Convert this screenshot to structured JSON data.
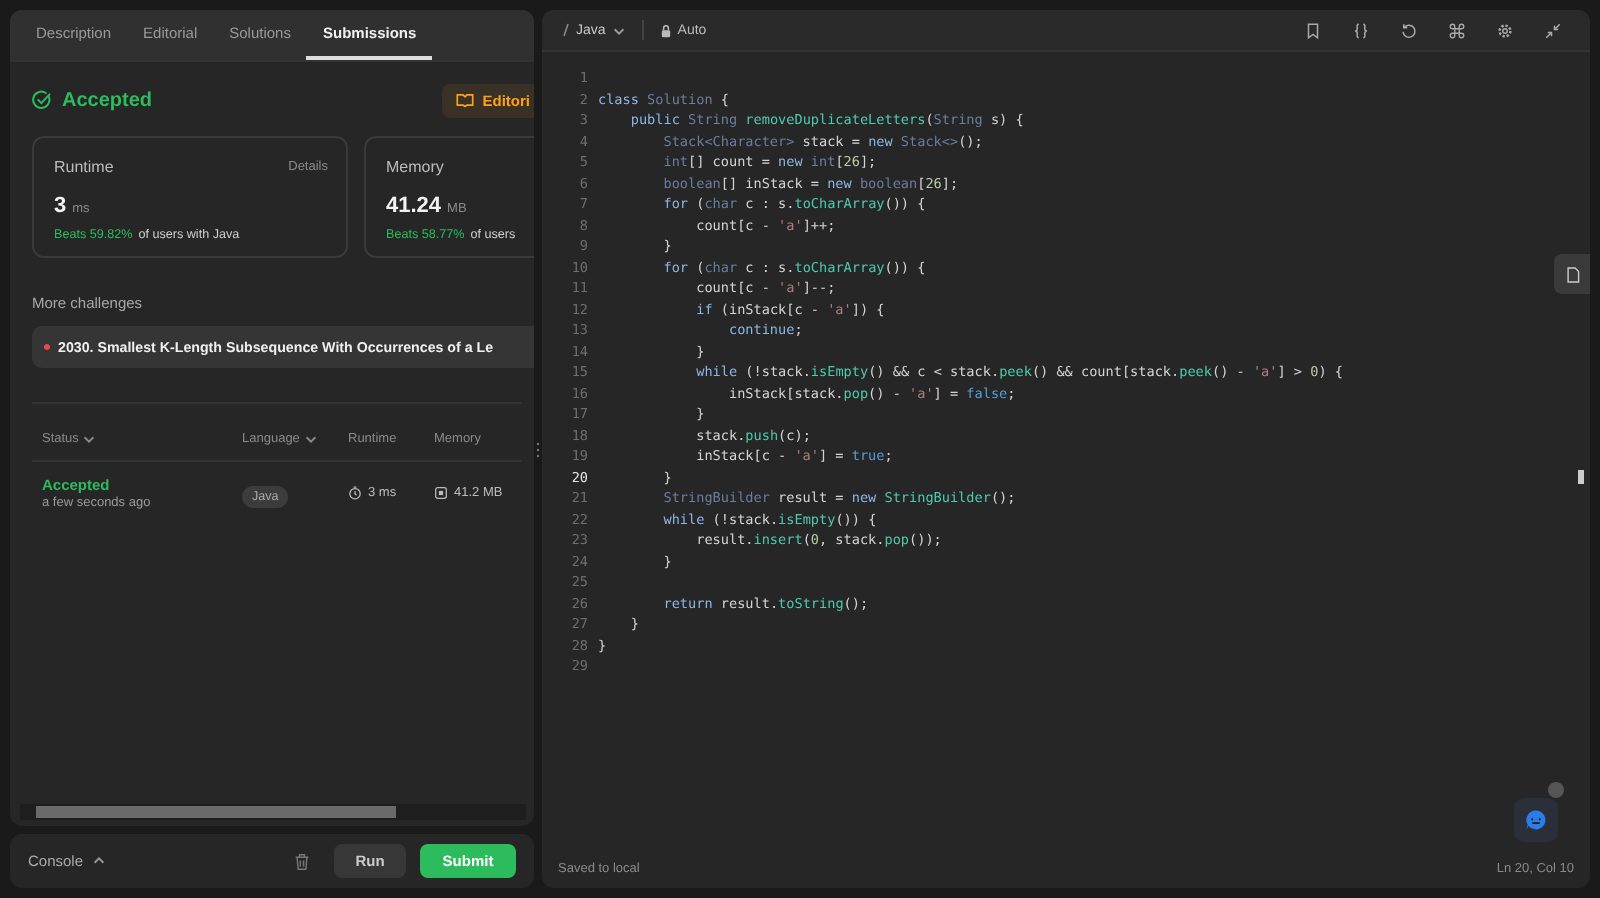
{
  "left_tabs": [
    {
      "label": "Description",
      "selected": false
    },
    {
      "label": "Editorial",
      "selected": false
    },
    {
      "label": "Solutions",
      "selected": false
    },
    {
      "label": "Submissions",
      "selected": true
    }
  ],
  "result": {
    "status": "Accepted",
    "editorial_button": "Editori"
  },
  "runtime_card": {
    "title": "Runtime",
    "details_link": "Details",
    "value": "3",
    "unit": "ms",
    "beats": "Beats 59.82%",
    "beats_suffix": "of users with Java"
  },
  "memory_card": {
    "title": "Memory",
    "value": "41.24",
    "unit": "MB",
    "beats": "Beats 58.77%",
    "beats_suffix": "of users"
  },
  "more_challenges": {
    "heading": "More challenges",
    "items": [
      {
        "title": "2030. Smallest K-Length Subsequence With Occurrences of a Le",
        "color": "#e5484d"
      }
    ]
  },
  "submissions": {
    "columns": [
      {
        "label": "Status",
        "sortable": true
      },
      {
        "label": "Language",
        "sortable": true
      },
      {
        "label": "Runtime",
        "sortable": false
      },
      {
        "label": "Memory",
        "sortable": false
      }
    ],
    "rows": [
      {
        "status": "Accepted",
        "time": "a few seconds ago",
        "language": "Java",
        "runtime": "3 ms",
        "memory": "41.2 MB"
      }
    ]
  },
  "bottom_bar": {
    "console": "Console",
    "run": "Run",
    "submit": "Submit"
  },
  "editor": {
    "language": "Java",
    "mode": "Auto",
    "status_left": "Saved to local",
    "cursor": "Ln 20, Col 10",
    "lines": [
      {
        "number": "1",
        "current": false
      },
      {
        "number": "2",
        "current": false,
        "tokens": [
          {
            "kind": "keyword",
            "text": "class"
          },
          {
            "kind": "type",
            "text": " Solution"
          },
          {
            "kind": "plain",
            "text": " {"
          }
        ]
      },
      {
        "number": "3",
        "current": false,
        "tokens": [
          {
            "kind": "keyword",
            "text": "    public"
          },
          {
            "kind": "type",
            "text": " String"
          },
          {
            "kind": "method",
            "text": " removeDuplicateLetters"
          },
          {
            "kind": "plain",
            "text": "("
          },
          {
            "kind": "type",
            "text": "String"
          },
          {
            "kind": "plain",
            "text": " s) {"
          }
        ]
      },
      {
        "number": "4",
        "current": false,
        "tokens": [
          {
            "kind": "type",
            "text": "        Stack<Character>"
          },
          {
            "kind": "plain",
            "text": " stack = "
          },
          {
            "kind": "keyword",
            "text": "new"
          },
          {
            "kind": "type",
            "text": " Stack<>"
          },
          {
            "kind": "plain",
            "text": "();"
          }
        ]
      },
      {
        "number": "5",
        "current": false,
        "tokens": [
          {
            "kind": "type",
            "text": "        int"
          },
          {
            "kind": "plain",
            "text": "[] count = "
          },
          {
            "kind": "keyword",
            "text": "new"
          },
          {
            "kind": "type",
            "text": " int"
          },
          {
            "kind": "plain",
            "text": "["
          },
          {
            "kind": "number",
            "text": "26"
          },
          {
            "kind": "plain",
            "text": "];"
          }
        ]
      },
      {
        "number": "6",
        "current": false,
        "tokens": [
          {
            "kind": "type",
            "text": "        boolean"
          },
          {
            "kind": "plain",
            "text": "[] inStack = "
          },
          {
            "kind": "keyword",
            "text": "new"
          },
          {
            "kind": "type",
            "text": " boolean"
          },
          {
            "kind": "plain",
            "text": "["
          },
          {
            "kind": "number",
            "text": "26"
          },
          {
            "kind": "plain",
            "text": "];"
          }
        ]
      },
      {
        "number": "7",
        "current": false,
        "tokens": [
          {
            "kind": "keyword",
            "text": "        for"
          },
          {
            "kind": "plain",
            "text": " ("
          },
          {
            "kind": "type",
            "text": "char"
          },
          {
            "kind": "plain",
            "text": " c : s."
          },
          {
            "kind": "method",
            "text": "toCharArray"
          },
          {
            "kind": "plain",
            "text": "()) {"
          }
        ]
      },
      {
        "number": "8",
        "current": false,
        "tokens": [
          {
            "kind": "plain",
            "text": "            count[c - "
          },
          {
            "kind": "string",
            "text": "'a'"
          },
          {
            "kind": "plain",
            "text": "]++;"
          }
        ]
      },
      {
        "number": "9",
        "current": false,
        "tokens": [
          {
            "kind": "plain",
            "text": "        }"
          }
        ]
      },
      {
        "number": "10",
        "current": false,
        "tokens": [
          {
            "kind": "keyword",
            "text": "        for"
          },
          {
            "kind": "plain",
            "text": " ("
          },
          {
            "kind": "type",
            "text": "char"
          },
          {
            "kind": "plain",
            "text": " c : s."
          },
          {
            "kind": "method",
            "text": "toCharArray"
          },
          {
            "kind": "plain",
            "text": "()) {"
          }
        ]
      },
      {
        "number": "11",
        "current": false,
        "tokens": [
          {
            "kind": "plain",
            "text": "            count[c - "
          },
          {
            "kind": "string",
            "text": "'a'"
          },
          {
            "kind": "plain",
            "text": "]--;"
          }
        ]
      },
      {
        "number": "12",
        "current": false,
        "tokens": [
          {
            "kind": "keyword",
            "text": "            if"
          },
          {
            "kind": "plain",
            "text": " (inStack[c - "
          },
          {
            "kind": "string",
            "text": "'a'"
          },
          {
            "kind": "plain",
            "text": "]) {"
          }
        ]
      },
      {
        "number": "13",
        "current": false,
        "tokens": [
          {
            "kind": "keyword",
            "text": "                continue"
          },
          {
            "kind": "plain",
            "text": ";"
          }
        ]
      },
      {
        "number": "14",
        "current": false,
        "tokens": [
          {
            "kind": "plain",
            "text": "            }"
          }
        ]
      },
      {
        "number": "15",
        "current": false,
        "tokens": [
          {
            "kind": "keyword",
            "text": "            while"
          },
          {
            "kind": "plain",
            "text": " (!stack."
          },
          {
            "kind": "method",
            "text": "isEmpty"
          },
          {
            "kind": "plain",
            "text": "() && c < stack."
          },
          {
            "kind": "method",
            "text": "peek"
          },
          {
            "kind": "plain",
            "text": "() && count[stack."
          },
          {
            "kind": "method",
            "text": "peek"
          },
          {
            "kind": "plain",
            "text": "() - "
          },
          {
            "kind": "string",
            "text": "'a'"
          },
          {
            "kind": "plain",
            "text": "] > "
          },
          {
            "kind": "number",
            "text": "0"
          },
          {
            "kind": "plain",
            "text": ") {"
          }
        ]
      },
      {
        "number": "16",
        "current": false,
        "tokens": [
          {
            "kind": "plain",
            "text": "                inStack[stack."
          },
          {
            "kind": "method",
            "text": "pop"
          },
          {
            "kind": "plain",
            "text": "() - "
          },
          {
            "kind": "string",
            "text": "'a'"
          },
          {
            "kind": "plain",
            "text": "] = "
          },
          {
            "kind": "literal",
            "text": "false"
          },
          {
            "kind": "plain",
            "text": ";"
          }
        ]
      },
      {
        "number": "17",
        "current": false,
        "tokens": [
          {
            "kind": "plain",
            "text": "            }"
          }
        ]
      },
      {
        "number": "18",
        "current": false,
        "tokens": [
          {
            "kind": "plain",
            "text": "            stack."
          },
          {
            "kind": "method",
            "text": "push"
          },
          {
            "kind": "plain",
            "text": "(c);"
          }
        ]
      },
      {
        "number": "19",
        "current": false,
        "tokens": [
          {
            "kind": "plain",
            "text": "            inStack[c - "
          },
          {
            "kind": "string",
            "text": "'a'"
          },
          {
            "kind": "plain",
            "text": "] = "
          },
          {
            "kind": "literal",
            "text": "true"
          },
          {
            "kind": "plain",
            "text": ";"
          }
        ]
      },
      {
        "number": "20",
        "current": true,
        "tokens": [
          {
            "kind": "plain",
            "text": "        }"
          }
        ]
      },
      {
        "number": "21",
        "current": false,
        "tokens": [
          {
            "kind": "type",
            "text": "        StringBuilder"
          },
          {
            "kind": "plain",
            "text": " result = "
          },
          {
            "kind": "keyword",
            "text": "new"
          },
          {
            "kind": "method",
            "text": " StringBuilder"
          },
          {
            "kind": "plain",
            "text": "();"
          }
        ]
      },
      {
        "number": "22",
        "current": false,
        "tokens": [
          {
            "kind": "keyword",
            "text": "        while"
          },
          {
            "kind": "plain",
            "text": " (!stack."
          },
          {
            "kind": "method",
            "text": "isEmpty"
          },
          {
            "kind": "plain",
            "text": "()) {"
          }
        ]
      },
      {
        "number": "23",
        "current": false,
        "tokens": [
          {
            "kind": "plain",
            "text": "            result."
          },
          {
            "kind": "method",
            "text": "insert"
          },
          {
            "kind": "plain",
            "text": "("
          },
          {
            "kind": "number",
            "text": "0"
          },
          {
            "kind": "plain",
            "text": ", stack."
          },
          {
            "kind": "method",
            "text": "pop"
          },
          {
            "kind": "plain",
            "text": "());"
          }
        ]
      },
      {
        "number": "24",
        "current": false,
        "tokens": [
          {
            "kind": "plain",
            "text": "        }"
          }
        ]
      },
      {
        "number": "25",
        "current": false
      },
      {
        "number": "26",
        "current": false,
        "tokens": [
          {
            "kind": "keyword",
            "text": "        return"
          },
          {
            "kind": "plain",
            "text": " result."
          },
          {
            "kind": "method",
            "text": "toString"
          },
          {
            "kind": "plain",
            "text": "();"
          }
        ]
      },
      {
        "number": "27",
        "current": false,
        "tokens": [
          {
            "kind": "plain",
            "text": "    }"
          }
        ]
      },
      {
        "number": "28",
        "current": false,
        "tokens": [
          {
            "kind": "plain",
            "text": "}"
          }
        ]
      },
      {
        "number": "29",
        "current": false
      }
    ]
  }
}
